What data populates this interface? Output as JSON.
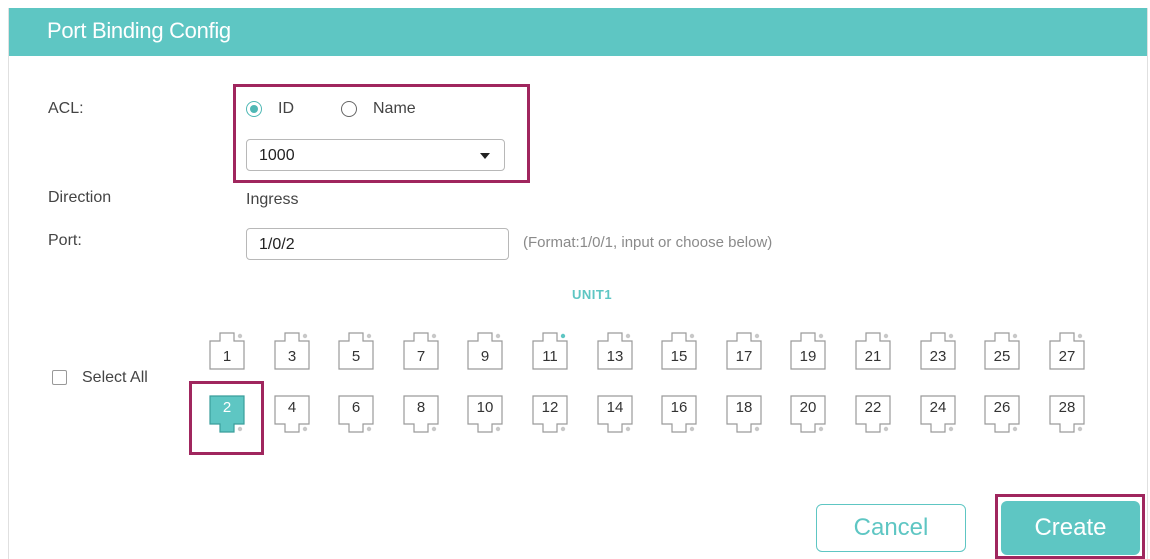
{
  "panel": {
    "title": "Port Binding Config"
  },
  "acl": {
    "label": "ACL:",
    "options": [
      {
        "label": "ID",
        "checked": true
      },
      {
        "label": "Name",
        "checked": false
      }
    ],
    "selected_value": "1000"
  },
  "direction": {
    "label": "Direction",
    "value": "Ingress"
  },
  "port": {
    "label": "Port:",
    "value": "1/0/2",
    "hint": "(Format:1/0/1, input or choose below)"
  },
  "unit": {
    "label": "UNIT1"
  },
  "select_all": {
    "label": "Select All",
    "checked": false
  },
  "ports": {
    "odd": [
      "1",
      "3",
      "5",
      "7",
      "9",
      "11",
      "13",
      "15",
      "17",
      "19",
      "21",
      "23",
      "25",
      "27"
    ],
    "even": [
      "2",
      "4",
      "6",
      "8",
      "10",
      "12",
      "14",
      "16",
      "18",
      "20",
      "22",
      "24",
      "26",
      "28"
    ],
    "selected": "2",
    "active_led": "11"
  },
  "buttons": {
    "cancel": "Cancel",
    "create": "Create"
  },
  "colors": {
    "accent": "#5ec6c3",
    "highlight": "#a0265e"
  }
}
